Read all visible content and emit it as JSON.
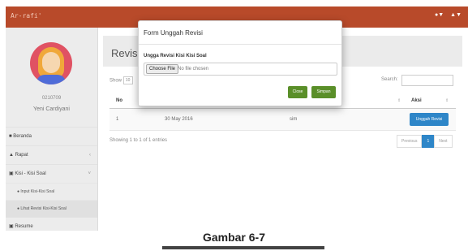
{
  "app": {
    "brand": "Ar-rafi'",
    "colors": {
      "topbar": "#b84a2a",
      "primary_button": "#2e86c8",
      "modal_button": "#5a8f29"
    }
  },
  "user": {
    "id": "0210709",
    "name": "Yeni Cardiyani"
  },
  "sidebar": {
    "items": [
      {
        "label": "Beranda",
        "icon": "home-icon"
      },
      {
        "label": "Rapat",
        "icon": "user-icon"
      },
      {
        "label": "Kisi - Kisi Soal",
        "icon": "book-icon"
      },
      {
        "label": "Resume",
        "icon": "book-icon"
      }
    ],
    "sub_items": [
      {
        "label": "Input Kisi-Kisi Soal"
      },
      {
        "label": "Lihat Revisi Kisi-Kisi Soal"
      }
    ]
  },
  "main": {
    "title": "Revisi K",
    "show_label": "Show",
    "show_value": "10",
    "search_label": "Search:",
    "table": {
      "headers": [
        "No",
        "",
        "",
        "Aksi"
      ],
      "rows": [
        {
          "no": "1",
          "date": "30 May 2016",
          "note": "sim",
          "action": "Unggah Revisi"
        }
      ]
    },
    "info": "Showing 1 to 1 of 1 entries",
    "pagination": {
      "previous": "Previous",
      "page": "1",
      "next": "Next"
    }
  },
  "modal": {
    "title": "Form Unggah Revisi",
    "label": "Ungga Revisi Kisi Kisi Soal",
    "file_button": "Choose File",
    "file_status": "No file chosen",
    "close": "Close",
    "save": "Simpan"
  },
  "caption": {
    "text": "Gambar 6-7"
  }
}
